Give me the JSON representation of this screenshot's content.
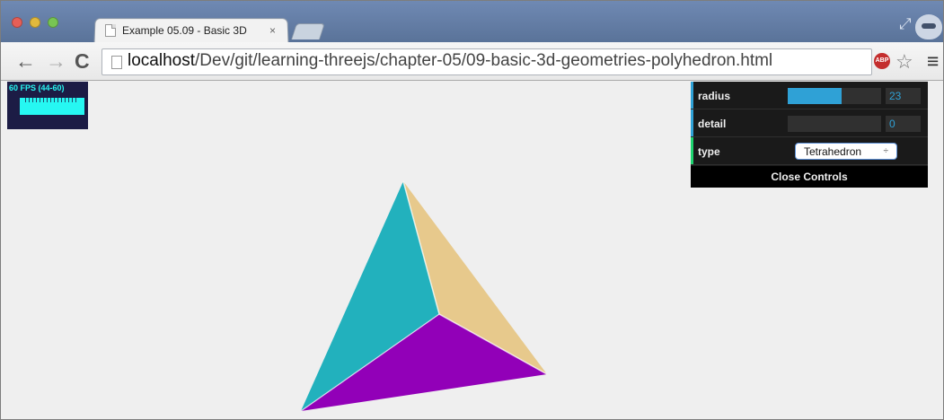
{
  "browser": {
    "tab": {
      "title": "Example 05.09 - Basic 3D",
      "close": "×"
    },
    "address": {
      "host": "localhost",
      "path": "/Dev/git/learning-threejs/chapter-05/09-basic-3d-geometries-polyhedron.html"
    },
    "nav": {
      "back": "←",
      "forward": "→",
      "reload": "C"
    },
    "extensions": {
      "adblock": "ABP",
      "star": "☆",
      "menu": "≡",
      "fullscreen": "⤢"
    }
  },
  "stats": {
    "fps": "60 FPS (44-60)"
  },
  "controls": {
    "radius": {
      "label": "radius",
      "value": "23",
      "fraction": 0.6
    },
    "detail": {
      "label": "detail",
      "value": "0",
      "fraction": 0.0
    },
    "type": {
      "label": "type",
      "selected": "Tetrahedron",
      "arrow": "÷"
    },
    "close_label": "Close Controls"
  },
  "colors": {
    "face_left": "#22b1bd",
    "face_right": "#e7c98c",
    "face_bottom": "#9200b8",
    "slider": "#2fa1d6",
    "control_bg": "#1a1a1a"
  }
}
